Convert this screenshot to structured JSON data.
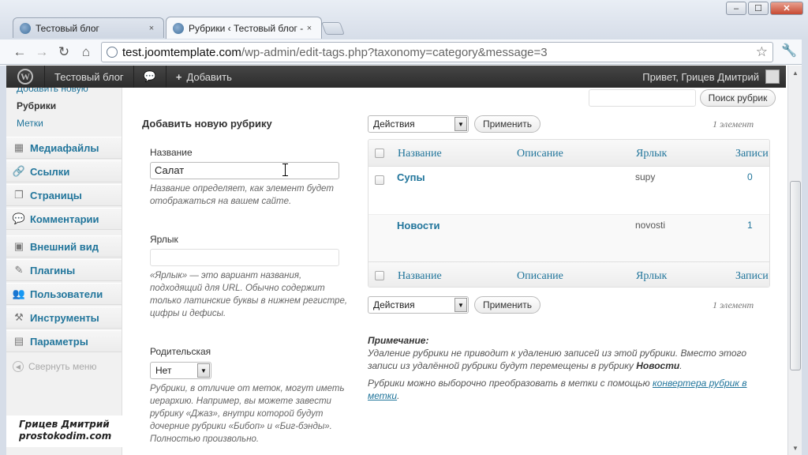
{
  "browser": {
    "tabs": [
      {
        "title": "Тестовый блог",
        "close": "×"
      },
      {
        "title": "Рубрики ‹ Тестовый блог -",
        "close": "×"
      }
    ],
    "url_host": "test.joomtemplate.com",
    "url_path": "/wp-admin/edit-tags.php?taxonomy=category&message=3",
    "window_buttons": {
      "minimize": "‒",
      "maximize": "☐",
      "close": "✕"
    }
  },
  "adminbar": {
    "logo": "W",
    "site_name": "Тестовый блог",
    "comments_icon": "💬",
    "add_plus": "+",
    "add_label": "Добавить",
    "greeting": "Привет, Грицев Дмитрий"
  },
  "sidebar": {
    "sub_items": [
      "Добавить новую",
      "Рубрики",
      "Метки"
    ],
    "menu": [
      {
        "label": "Медиафайлы",
        "icon": "media-icon",
        "glyph": "▦"
      },
      {
        "label": "Ссылки",
        "icon": "links-icon",
        "glyph": "🔗"
      },
      {
        "label": "Страницы",
        "icon": "pages-icon",
        "glyph": "❐"
      },
      {
        "label": "Комментарии",
        "icon": "comments-icon",
        "glyph": "💬"
      },
      {
        "label": "Внешний вид",
        "icon": "appearance-icon",
        "glyph": "▣"
      },
      {
        "label": "Плагины",
        "icon": "plugins-icon",
        "glyph": "✎"
      },
      {
        "label": "Пользователи",
        "icon": "users-icon",
        "glyph": "👥"
      },
      {
        "label": "Инструменты",
        "icon": "tools-icon",
        "glyph": "⚒"
      },
      {
        "label": "Параметры",
        "icon": "settings-icon",
        "glyph": "▤"
      }
    ],
    "collapse_label": "Свернуть меню",
    "collapse_glyph": "◀"
  },
  "watermark": {
    "line1": "Грицев Дмитрий",
    "line2": "prostokodim.com"
  },
  "form": {
    "title": "Добавить новую рубрику",
    "name_label": "Название",
    "name_value": "Салат",
    "name_desc": "Название определяет, как элемент будет отображаться на вашем сайте.",
    "slug_label": "Ярлык",
    "slug_value": "",
    "slug_desc": "«Ярлык» — это вариант названия, подходящий для URL. Обычно содержит только латинские буквы в нижнем регистре, цифры и дефисы.",
    "parent_label": "Родительская",
    "parent_value": "Нет",
    "parent_desc": "Рубрики, в отличие от меток, могут иметь иерархию. Например, вы можете завести рубрику «Джаз», внутри которой будут дочерние рубрики «Бибоп» и «Биг-бэнды». Полностью произвольно."
  },
  "list": {
    "search_button": "Поиск рубрик",
    "bulk_action": "Действия",
    "apply_button": "Применить",
    "count": "1 элемент",
    "columns": [
      "Название",
      "Описание",
      "Ярлык",
      "Записи"
    ],
    "rows": [
      {
        "name": "Супы",
        "description": "",
        "slug": "supy",
        "posts": "0"
      },
      {
        "name": "Новости",
        "description": "",
        "slug": "novosti",
        "posts": "1"
      }
    ],
    "note_title": "Примечание:",
    "note_text_1": "Удаление рубрики не приводит к удалению записей из этой рубрики. Вместо этого записи из удалённой рубрики будут перемещены в рубрику ",
    "note_default_cat": "Новости",
    "note_text_1_end": ".",
    "note_text_2": "Рубрики можно выборочно преобразовать в метки с помощью ",
    "note_link": "конвертера рубрик в метки",
    "note_text_2_end": "."
  }
}
